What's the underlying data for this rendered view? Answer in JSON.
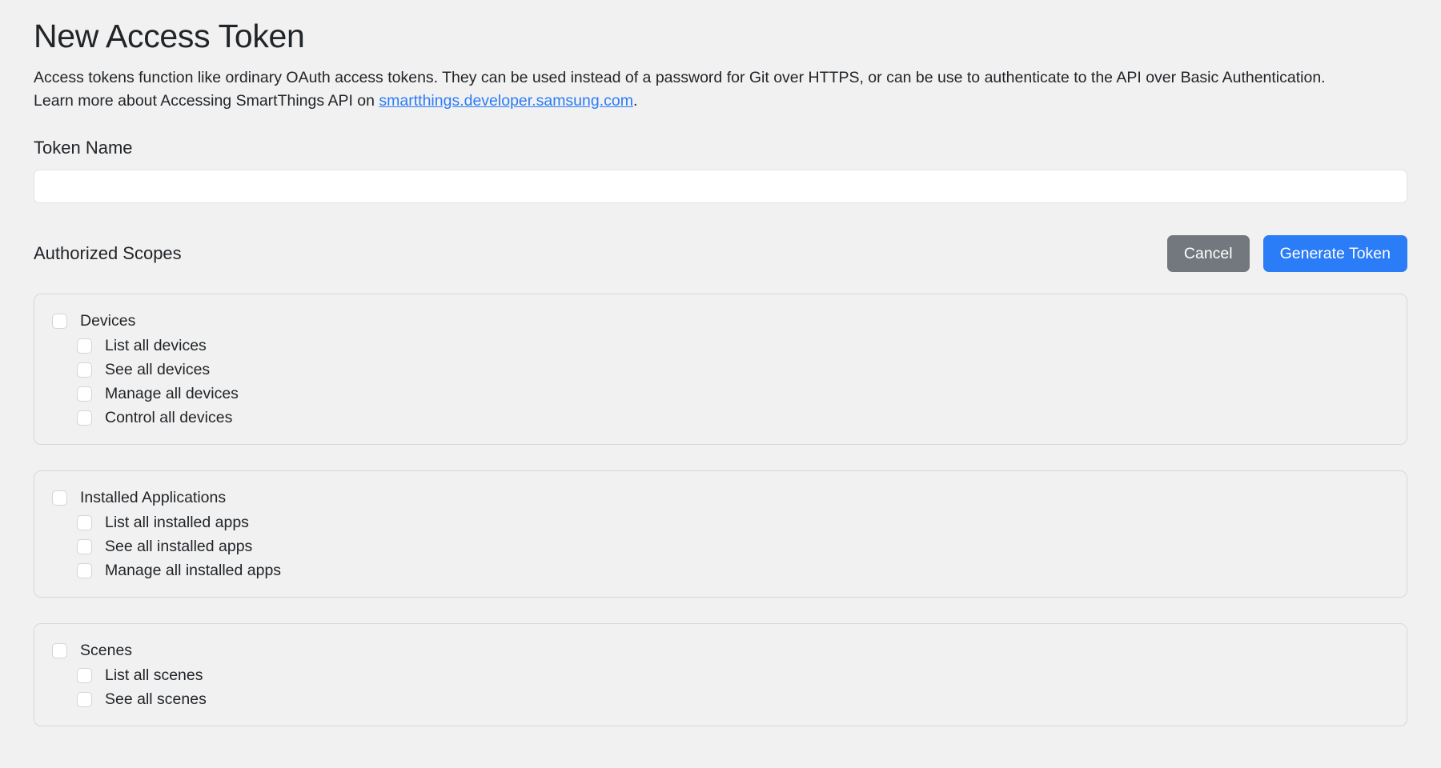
{
  "page": {
    "title": "New Access Token",
    "description_part1": "Access tokens function like ordinary OAuth access tokens. They can be used instead of a password for Git over HTTPS, or can be use to authenticate to the API over Basic Authentication. Learn more about Accessing SmartThings API on ",
    "description_link": "smartthings.developer.samsung.com",
    "description_part2": "."
  },
  "token_name": {
    "label": "Token Name",
    "value": "",
    "placeholder": ""
  },
  "scopes": {
    "label": "Authorized Scopes",
    "cancel_label": "Cancel",
    "generate_label": "Generate Token",
    "groups": [
      {
        "label": "Devices",
        "checked": false,
        "items": [
          {
            "label": "List all devices",
            "checked": false
          },
          {
            "label": "See all devices",
            "checked": false
          },
          {
            "label": "Manage all devices",
            "checked": false
          },
          {
            "label": "Control all devices",
            "checked": false
          }
        ]
      },
      {
        "label": "Installed Applications",
        "checked": false,
        "items": [
          {
            "label": "List all installed apps",
            "checked": false
          },
          {
            "label": "See all installed apps",
            "checked": false
          },
          {
            "label": "Manage all installed apps",
            "checked": false
          }
        ]
      },
      {
        "label": "Scenes",
        "checked": false,
        "items": [
          {
            "label": "List all scenes",
            "checked": false
          },
          {
            "label": "See all scenes",
            "checked": false
          }
        ]
      }
    ]
  },
  "colors": {
    "background": "#f1f1f1",
    "accent": "#2b7cf7",
    "cancel": "#72787e",
    "text": "#212529",
    "card_border": "#d6d8da"
  }
}
